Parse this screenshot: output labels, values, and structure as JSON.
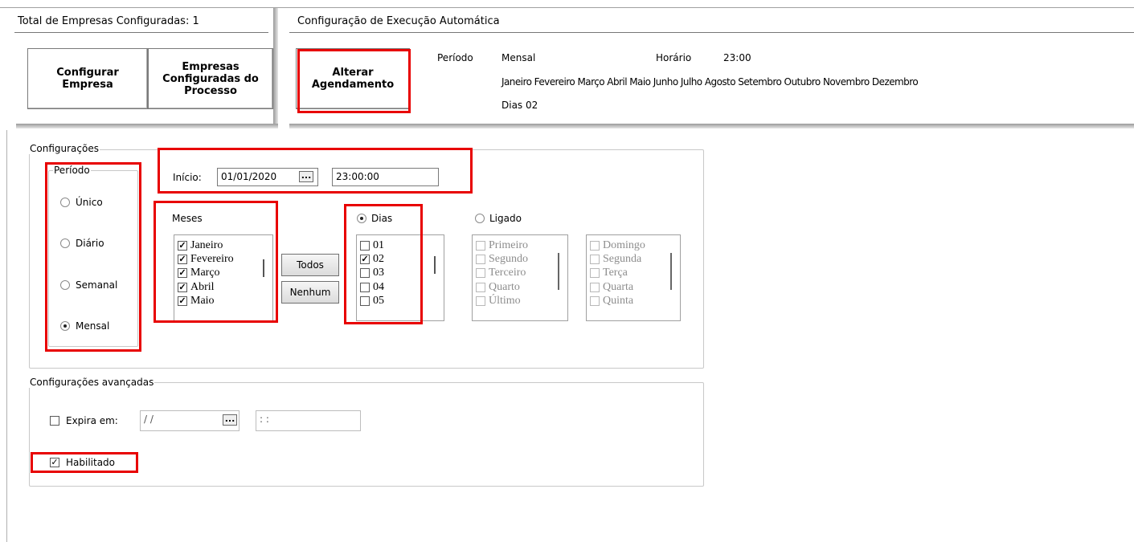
{
  "header": {
    "total_label": "Total de Empresas Configuradas: 1",
    "config_title": "Configuração de Execução Automática",
    "configurar_empresa_l1": "Configurar",
    "configurar_empresa_l2": "Empresa",
    "empresas_processo_l1": "Empresas",
    "empresas_processo_l2": "Configuradas do",
    "empresas_processo_l3": "Processo",
    "alterar_l1": "Alterar",
    "alterar_l2": "Agendamento"
  },
  "schedule": {
    "periodo_label": "Período",
    "periodo_value": "Mensal",
    "horario_label": "Horário",
    "horario_value": "23:00",
    "meses_text": "Janeiro Fevereiro Março Abril Maio Junho Julho Agosto Setembro Outubro Novembro Dezembro",
    "dias_label": "Dias",
    "dias_value": "02"
  },
  "configuracoes": {
    "title": "Configurações",
    "periodo_title": "Período",
    "periodo_options": [
      {
        "label": "Único",
        "selected": false
      },
      {
        "label": "Diário",
        "selected": false
      },
      {
        "label": "Semanal",
        "selected": false
      },
      {
        "label": "Mensal",
        "selected": true
      }
    ],
    "inicio_label": "Início:",
    "inicio_date": "01/01/2020",
    "inicio_time": "23:00:00",
    "date_btn": "...",
    "meses_label": "Meses",
    "meses": [
      {
        "label": "Janeiro",
        "checked": true
      },
      {
        "label": "Fevereiro",
        "checked": true
      },
      {
        "label": "Março",
        "checked": true
      },
      {
        "label": "Abril",
        "checked": true
      },
      {
        "label": "Maio",
        "checked": true
      }
    ],
    "todos_button": "Todos",
    "nenhum_button": "Nenhum",
    "dias_radio_label": "Dias",
    "dias_radio_selected": true,
    "dias_list": [
      {
        "label": "01",
        "checked": false
      },
      {
        "label": "02",
        "checked": true
      },
      {
        "label": "03",
        "checked": false
      },
      {
        "label": "04",
        "checked": false
      },
      {
        "label": "05",
        "checked": false
      }
    ],
    "ligado_label": "Ligado",
    "ligado_selected": false,
    "ordinal_list": [
      "Primeiro",
      "Segundo",
      "Terceiro",
      "Quarto",
      "Último"
    ],
    "weekday_list": [
      "Domingo",
      "Segunda",
      "Terça",
      "Quarta",
      "Quinta"
    ]
  },
  "avancadas": {
    "title": "Configurações avançadas",
    "expira_label": "Expira em:",
    "expira_checked": false,
    "expira_date": "/ /",
    "expira_time": ": :",
    "date_btn": "...",
    "habilitado_label": "Habilitado",
    "habilitado_checked": true
  },
  "colors": {
    "highlight": "#e80000"
  }
}
